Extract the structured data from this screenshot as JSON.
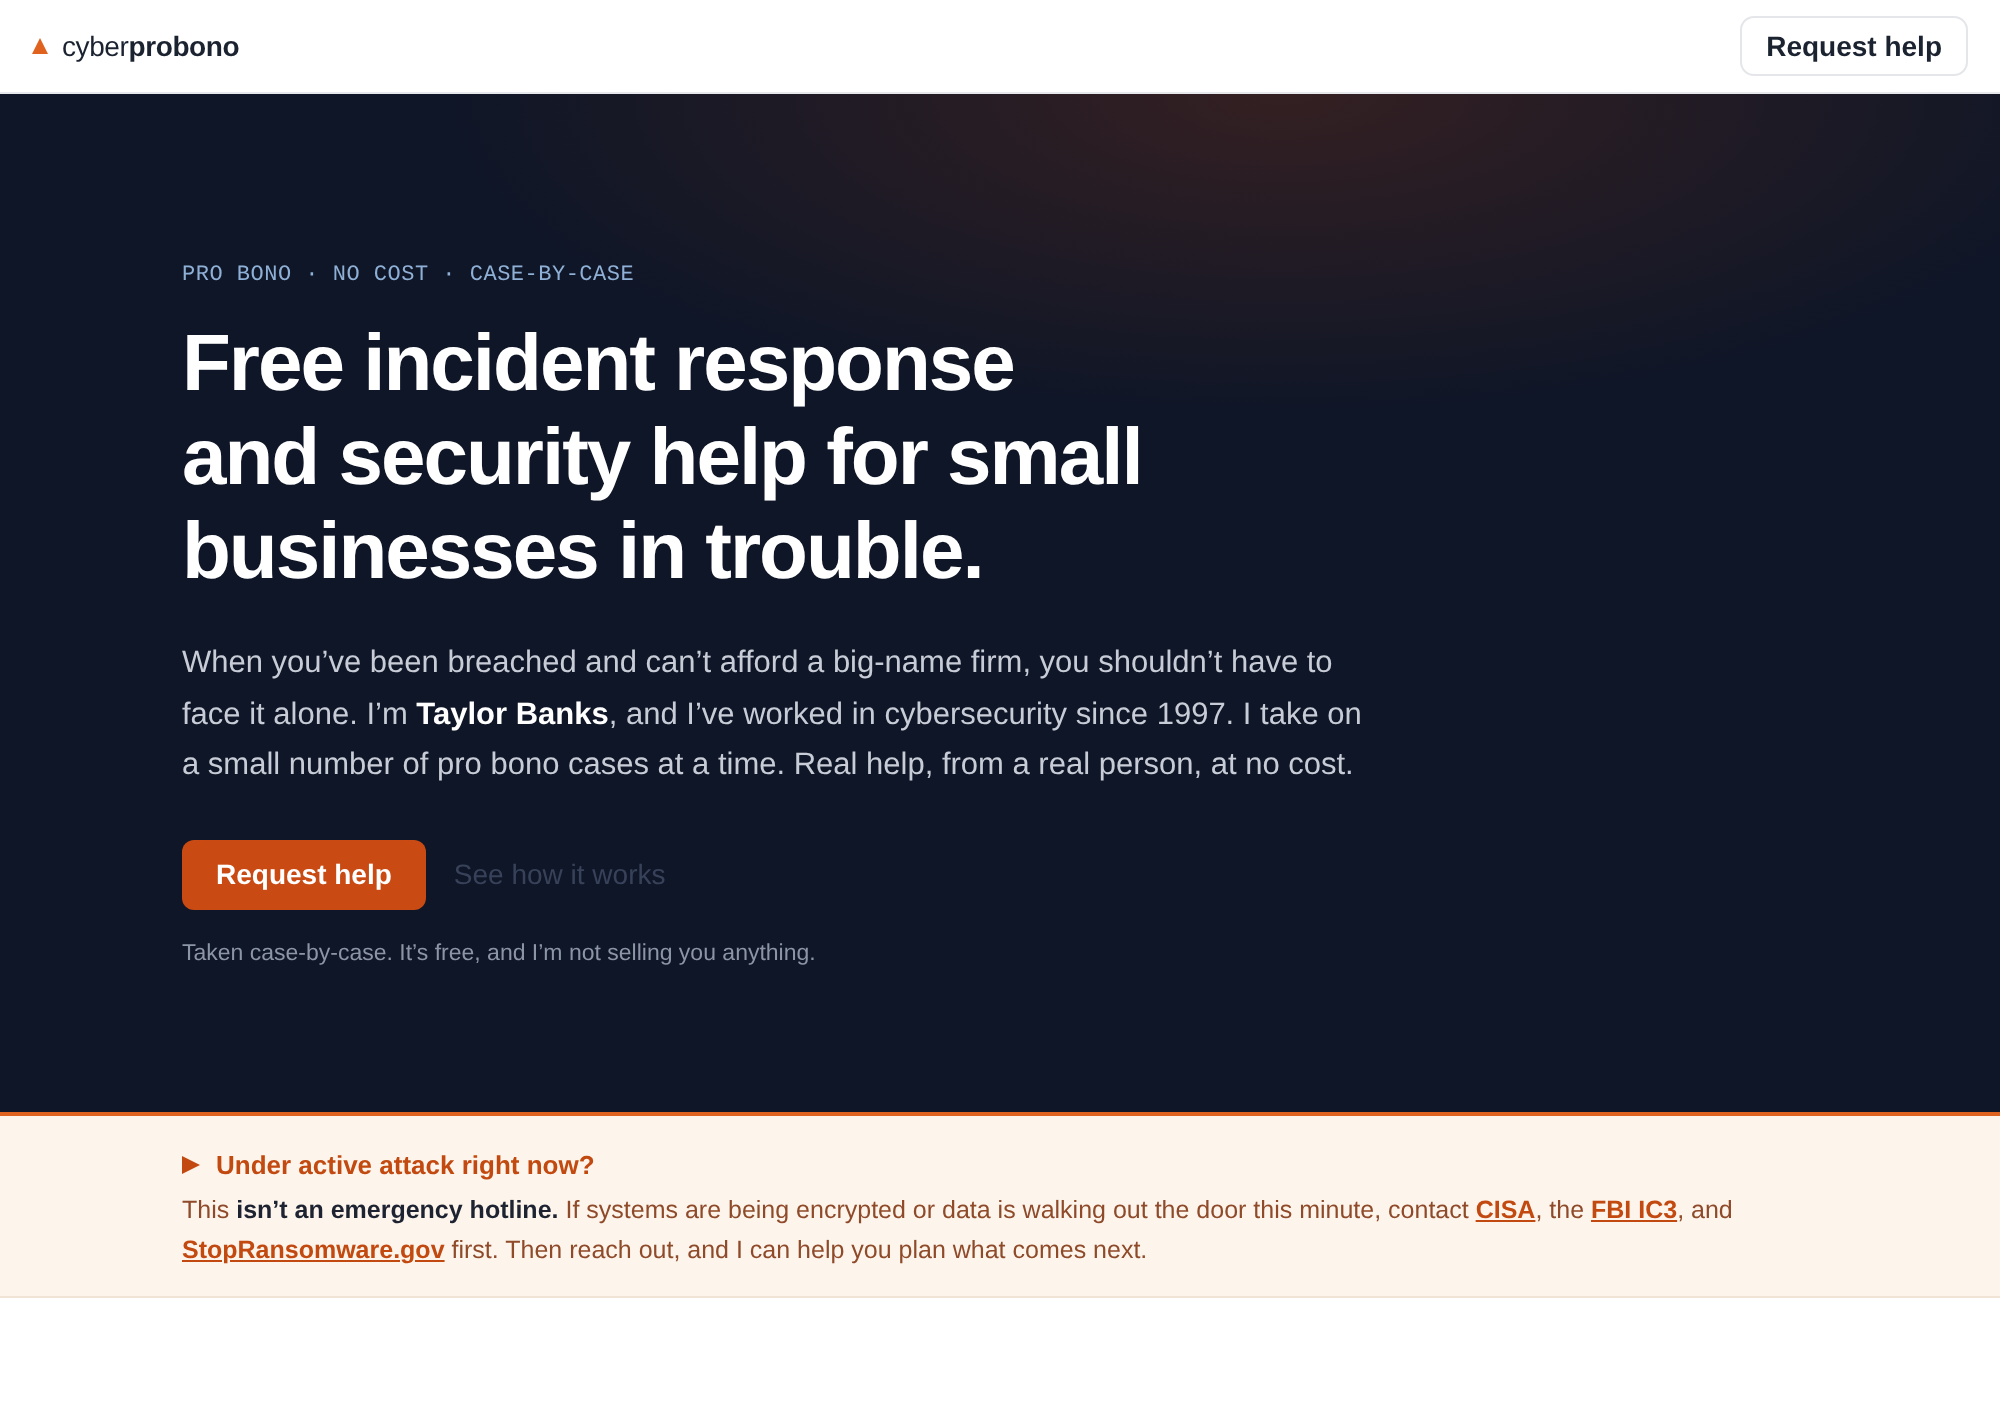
{
  "header": {
    "logo": "cyber**probono**",
    "button": "Request help"
  },
  "hero": {
    "eyebrow": "PRO BONO · NO COST · CASE-BY-CASE",
    "heading": "Free incident response and security help for small businesses in trouble.",
    "intro": "When you’ve been breached and can’t afford a big-name firm, you shouldn’t have to face it alone. I’m **Taylor Banks**, and I’ve worked in cybersecurity since 1997. I take on a small number of pro bono cases at a time. Real help, from a real person, at no cost.",
    "primary_button": "Request help",
    "secondary_link": "See how it works",
    "note": "Taken case-by-case. It’s free, and I’m not selling you anything."
  },
  "alert": {
    "title": "Under active attack right now?",
    "body": [
      {
        "kind": "text",
        "text": "This **isn’t an emergency hotline.** If systems are being encrypted or data is walking out the door this minute, contact "
      },
      {
        "kind": "link",
        "text": "CISA"
      },
      {
        "kind": "text",
        "text": ", the "
      },
      {
        "kind": "link",
        "text": "FBI IC3"
      },
      {
        "kind": "text",
        "text": ", and "
      },
      {
        "kind": "link",
        "text": "StopRansomware.gov"
      },
      {
        "kind": "text",
        "text": " first. Then reach out, and I can help you plan what comes next."
      }
    ]
  }
}
